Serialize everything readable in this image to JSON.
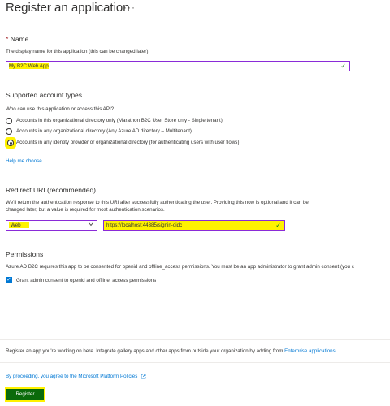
{
  "header": {
    "title": "Register an application",
    "more": "···"
  },
  "name_section": {
    "label": "Name",
    "required_marker": "*",
    "help": "The display name for this application (this can be changed later).",
    "value": "My B2C Web App"
  },
  "account_types": {
    "heading": "Supported account types",
    "question": "Who can use this application or access this API?",
    "options": [
      "Accounts in this organizational directory only (Marathon B2C User Store only - Single tenant)",
      "Accounts in any organizational directory (Any Azure AD directory – Multitenant)",
      "Accounts in any identity provider or organizational directory (for authenticating users with user flows)"
    ],
    "selected_index": 2,
    "help_link": "Help me choose..."
  },
  "redirect": {
    "heading": "Redirect URI (recommended)",
    "description_line1": "We'll return the authentication response to this URI after successfully authenticating the user. Providing this now is optional and it can be",
    "description_line2": "changed later, but a value is required for most authentication scenarios.",
    "platform": "Web",
    "uri": "https://localhost:44385/signin-oidc"
  },
  "permissions": {
    "heading": "Permissions",
    "description": "Azure AD B2C requires this app to be consented for openid and offline_access permissions. You must be an app administrator to grant admin consent (you c",
    "checkbox_label": "Grant admin consent to openid and offline_access permissions",
    "checked": true
  },
  "footer": {
    "info_text": "Register an app you're working on here. Integrate gallery apps and other apps from outside your organization by adding from",
    "info_link": "Enterprise applications.",
    "policy_link": "By proceeding, you agree to the Microsoft Platform Policies",
    "register_label": "Register"
  },
  "colors": {
    "accent": "#0078d4",
    "highlight": "#fff200",
    "highlight_border": "#8a2bd8",
    "register_button": "#0b6a0b",
    "valid_check": "#107c10"
  }
}
